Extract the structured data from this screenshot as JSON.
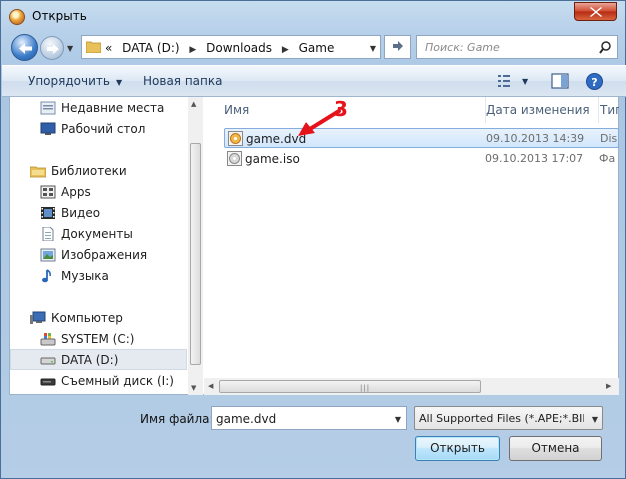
{
  "window": {
    "title": "Открыть"
  },
  "nav": {
    "breadcrumb_prefix": "«",
    "breadcrumb": [
      "DATA (D:)",
      "Downloads",
      "Game"
    ],
    "search_placeholder": "Поиск: Game"
  },
  "toolbar": {
    "organize": "Упорядочить",
    "new_folder": "Новая папка"
  },
  "sidebar": {
    "items": [
      {
        "label": "Недавние места",
        "icon": "recent-places-icon"
      },
      {
        "label": "Рабочий стол",
        "icon": "desktop-icon"
      },
      {
        "label": "Библиотеки",
        "icon": "libraries-icon"
      },
      {
        "label": "Apps",
        "icon": "apps-library-icon"
      },
      {
        "label": "Видео",
        "icon": "video-icon"
      },
      {
        "label": "Документы",
        "icon": "documents-icon"
      },
      {
        "label": "Изображения",
        "icon": "pictures-icon"
      },
      {
        "label": "Музыка",
        "icon": "music-icon"
      },
      {
        "label": "Компьютер",
        "icon": "computer-icon"
      },
      {
        "label": "SYSTEM (C:)",
        "icon": "system-drive-icon"
      },
      {
        "label": "DATA (D:)",
        "icon": "drive-icon",
        "selected": true
      },
      {
        "label": "Съемный диск (I:)",
        "icon": "removable-drive-icon"
      }
    ]
  },
  "columns": {
    "name": "Имя",
    "date": "Дата изменения",
    "type": "Тип"
  },
  "files": [
    {
      "name": "game.dvd",
      "date": "09.10.2013 14:39",
      "type": "Dis",
      "selected": true
    },
    {
      "name": "game.iso",
      "date": "09.10.2013 17:07",
      "type": "Фа"
    }
  ],
  "annotation": {
    "number": "3",
    "color": "#e6131b"
  },
  "bottom": {
    "filename_label": "Имя файла:",
    "filename_value": "game.dvd",
    "filter": "All Supported Files (*.APE;*.BIN",
    "open": "Открыть",
    "cancel": "Отмена"
  }
}
